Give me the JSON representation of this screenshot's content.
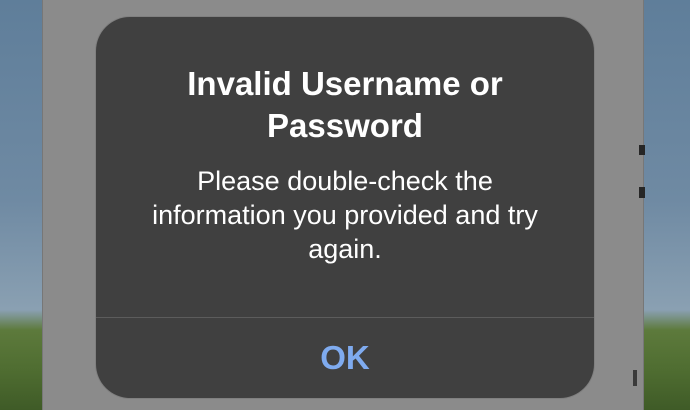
{
  "alert": {
    "title": "Invalid Username or Password",
    "message": "Please double-check the information you provided and try again.",
    "ok_label": "OK"
  },
  "colors": {
    "alert_background": "#404040",
    "alert_text": "#ffffff",
    "button_text": "#7fabef",
    "dimmed_page": "#8b8b8b"
  }
}
